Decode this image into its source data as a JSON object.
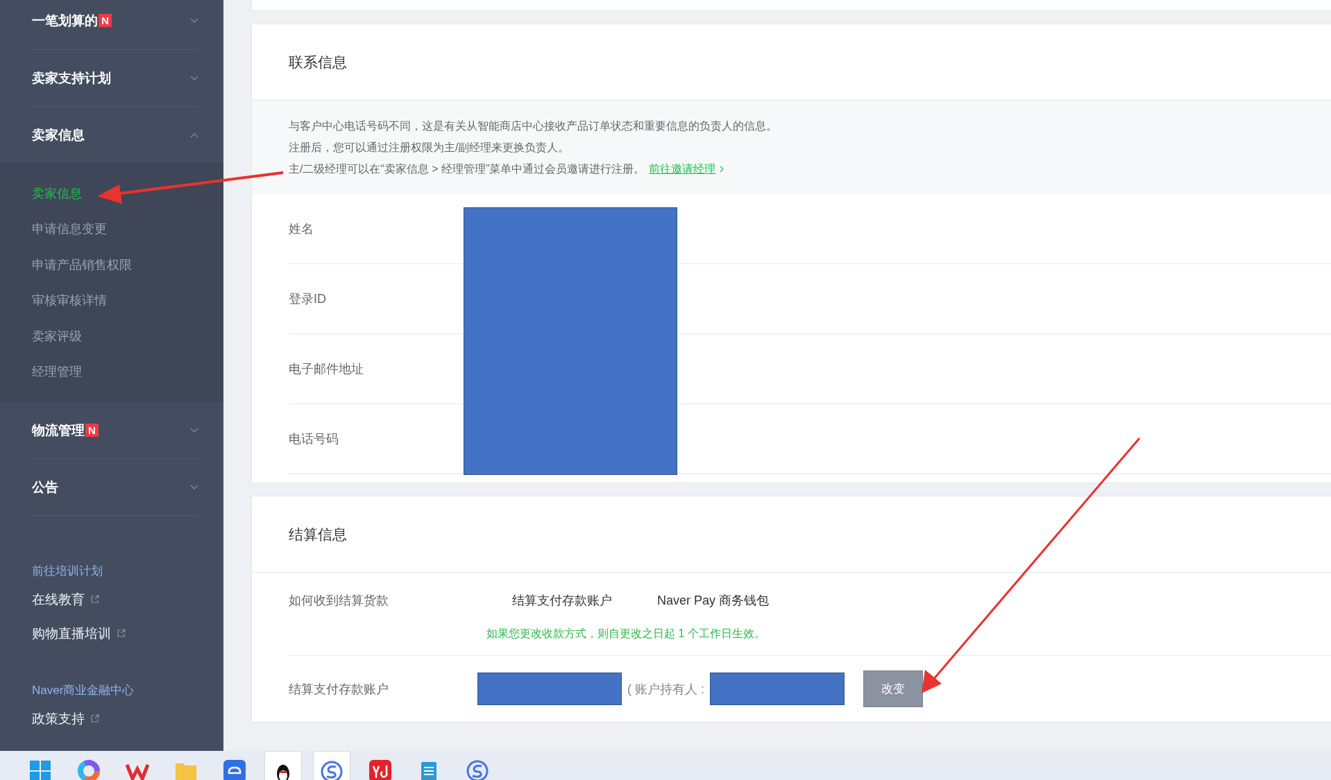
{
  "sidebar": {
    "menus": [
      {
        "label": "一笔划算的",
        "badge": "N",
        "expanded": false
      },
      {
        "label": "卖家支持计划",
        "expanded": false
      },
      {
        "label": "卖家信息",
        "expanded": true,
        "children": [
          {
            "label": "卖家信息",
            "selected": true
          },
          {
            "label": "申请信息变更",
            "selected": false
          },
          {
            "label": "申请产品销售权限",
            "selected": false
          },
          {
            "label": "审核审核详情",
            "selected": false
          },
          {
            "label": "卖家评级",
            "selected": false
          },
          {
            "label": "经理管理",
            "selected": false
          }
        ]
      },
      {
        "label": "物流管理",
        "badge": "N",
        "expanded": false
      },
      {
        "label": "公告",
        "expanded": false
      }
    ],
    "link_sections": [
      {
        "title": "前往培训计划",
        "links": [
          "在线教育",
          "购物直播培训"
        ]
      },
      {
        "title": "Naver商业金融中心",
        "links": [
          "政策支持"
        ]
      }
    ]
  },
  "contact": {
    "title": "联系信息",
    "notice": [
      "与客户中心电话号码不同，这是有关从智能商店中心接收产品订单状态和重要信息的负责人的信息。",
      "注册后，您可以通过注册权限为主/副经理来更换负责人。",
      "主/二级经理可以在“卖家信息 > 经理管理”菜单中通过会员邀请进行注册。"
    ],
    "notice_link": "前往邀请经理",
    "fields": [
      "姓名",
      "登录ID",
      "电子邮件地址",
      "电话号码"
    ]
  },
  "settlement": {
    "title": "结算信息",
    "method_label": "如何收到结算货款",
    "options": [
      "结算支付存款账户",
      "Naver Pay 商务钱包"
    ],
    "note": "如果您更改收款方式，则自更改之日起 1 个工作日生效。",
    "account_label": "结算支付存款账户",
    "holder_label": "( 账户持有人 :",
    "button": "改变"
  },
  "taskbar": [
    {
      "kind": "windows",
      "active": false
    },
    {
      "kind": "ring",
      "active": false
    },
    {
      "kind": "wps",
      "active": false
    },
    {
      "kind": "folder",
      "active": false
    },
    {
      "kind": "cloud",
      "active": false
    },
    {
      "kind": "penguin",
      "active": true
    },
    {
      "kind": "sogou",
      "active": true
    },
    {
      "kind": "yd",
      "active": false
    },
    {
      "kind": "notepad",
      "active": false
    },
    {
      "kind": "sogou",
      "active": false
    }
  ]
}
